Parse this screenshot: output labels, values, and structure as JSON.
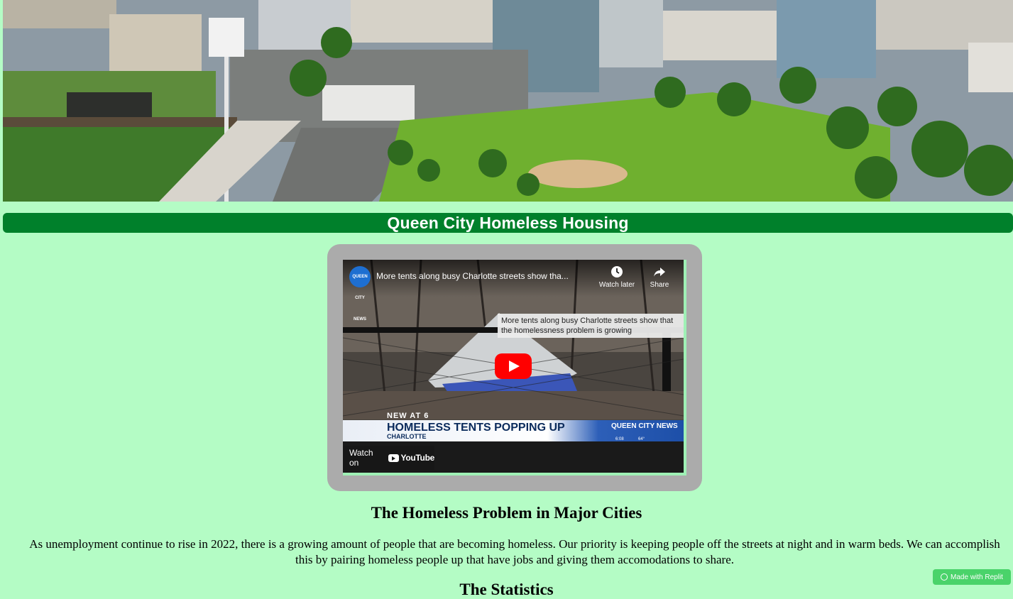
{
  "hero": {
    "alt": "Aerial view of Charlotte uptown with ballpark and green park"
  },
  "header": {
    "title": "Queen City Homeless Housing"
  },
  "video": {
    "channel_logo_text": "QUEEN CITY NEWS",
    "title": "More tents along busy Charlotte streets show tha...",
    "watch_later_label": "Watch later",
    "share_label": "Share",
    "tooltip": "More tents along busy Charlotte streets show that the homelessness problem is growing",
    "lower_third_tag": "NEW AT 6",
    "headline": "HOMELESS TENTS POPPING UP",
    "subline": "CHARLOTTE",
    "brand": "QUEEN CITY NEWS",
    "time": "6:08",
    "temp": "64°",
    "watch_on_label": "Watch on",
    "youtube_label": "YouTube",
    "icons": [
      "clock-icon",
      "share-arrow-icon",
      "play-icon",
      "youtube-logo-icon"
    ]
  },
  "content": {
    "section_heading": "The Homeless Problem in Major Cities",
    "intro": "As unemployment continue to rise in 2022, there is a growing amount of people that are becoming homeless. Our priority is keeping people off the streets at night and in warm beds. We can accomplish this by pairing homeless people up that have jobs and giving them accomodations to share.",
    "next_heading": "The Statistics"
  },
  "badge": {
    "label": "Made with Replit"
  },
  "colors": {
    "page_bg": "#b4fcc5",
    "title_bar": "#00802b",
    "video_frame": "#ababab",
    "youtube_red": "#ff0000"
  }
}
